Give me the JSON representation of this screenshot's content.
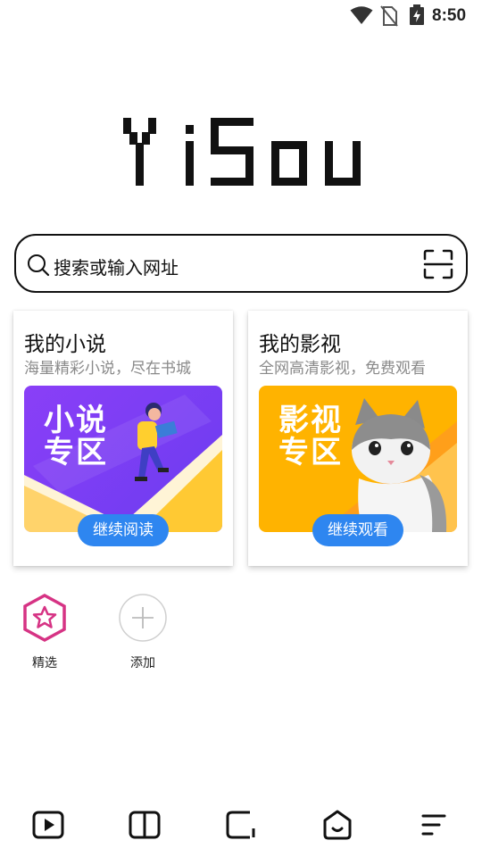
{
  "status_bar": {
    "time": "8:50"
  },
  "app": {
    "logo_text": "YiSou"
  },
  "search": {
    "placeholder": "搜索或输入网址"
  },
  "cards": {
    "novel": {
      "title": "我的小说",
      "subtitle": "海量精彩小说，尽在书城",
      "banner_line1": "小说",
      "banner_line2": "专区",
      "action": "继续阅读"
    },
    "video": {
      "title": "我的影视",
      "subtitle": "全网高清影视，免费观看",
      "banner_line1": "影视",
      "banner_line2": "专区",
      "action": "继续观看"
    }
  },
  "shortcuts": [
    {
      "label": "精选",
      "icon": "star-hexagon-icon"
    },
    {
      "label": "添加",
      "icon": "plus-circle-icon"
    }
  ],
  "bottom_nav": [
    {
      "icon": "play-icon"
    },
    {
      "icon": "book-icon"
    },
    {
      "icon": "tabs-icon"
    },
    {
      "icon": "home-icon"
    },
    {
      "icon": "menu-icon"
    }
  ],
  "colors": {
    "accent": "#2e86f0",
    "novel_banner": "#7b3ff2",
    "video_banner": "#ffb300",
    "featured": "#d63384"
  }
}
